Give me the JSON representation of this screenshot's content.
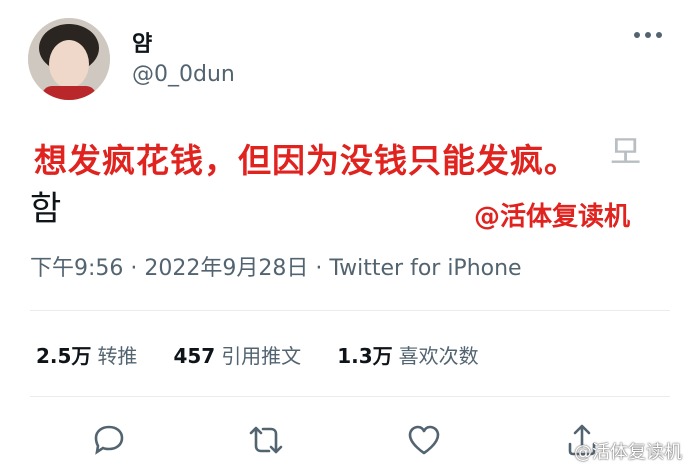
{
  "user": {
    "display_name": "얌",
    "handle": "@0_0dun",
    "avatar_icon": "profile-photo"
  },
  "tweet": {
    "text": "모 함",
    "meta": "下午9:56 · 2022年9月28日 · Twitter for iPhone"
  },
  "overlay": {
    "caption": "想发疯花钱，但因为没钱只能发疯。",
    "handle": "@活体复读机"
  },
  "stats": [
    {
      "value": "2.5万",
      "label": "转推"
    },
    {
      "value": "457",
      "label": "引用推文"
    },
    {
      "value": "1.3万",
      "label": "喜欢次数"
    }
  ],
  "actions": [
    "reply-icon",
    "retweet-icon",
    "like-icon",
    "share-icon"
  ],
  "watermark": "@活体复读机",
  "colors": {
    "accent_red": "#e0231f",
    "secondary_text": "#536471"
  }
}
